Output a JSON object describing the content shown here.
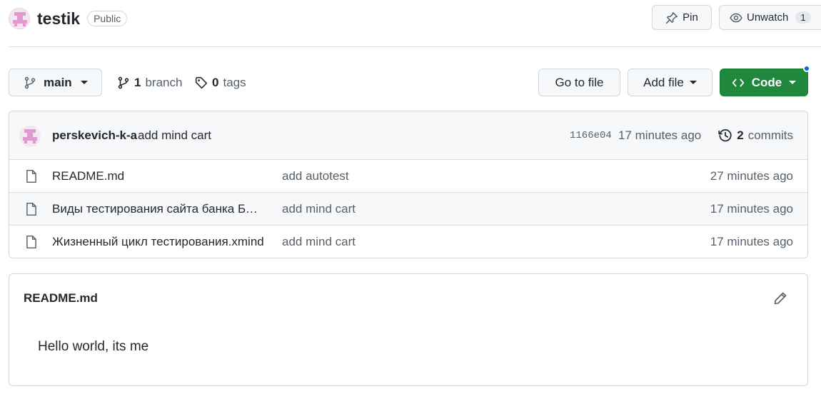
{
  "repo": {
    "name": "testik",
    "visibility": "Public"
  },
  "header_actions": {
    "pin_label": "Pin",
    "unwatch_label": "Unwatch",
    "watch_count": "1"
  },
  "toolbar": {
    "branch_name": "main",
    "branch_count": "1",
    "branch_label": "branch",
    "tag_count": "0",
    "tag_label": "tags",
    "go_to_file": "Go to file",
    "add_file": "Add file",
    "code": "Code"
  },
  "latest_commit": {
    "author": "perskevich-k-a",
    "message": "add mind cart",
    "sha": "1166e04",
    "time": "17 minutes ago",
    "commit_count": "2",
    "commit_label": "commits"
  },
  "files": [
    {
      "name": "README.md",
      "commit_message": "add autotest",
      "time": "27 minutes ago"
    },
    {
      "name": "Виды тестирования сайта банка БСПБ.xmind",
      "commit_message": "add mind cart",
      "time": "17 minutes ago"
    },
    {
      "name": "Жизненный цикл тестирования.xmind",
      "commit_message": "add mind cart",
      "time": "17 minutes ago"
    }
  ],
  "readme": {
    "title": "README.md",
    "content": "Hello world, its me"
  },
  "colors": {
    "code_button": "#1f883d",
    "notification_dot": "#0969da",
    "avatar_pink": "#e09ad0"
  }
}
